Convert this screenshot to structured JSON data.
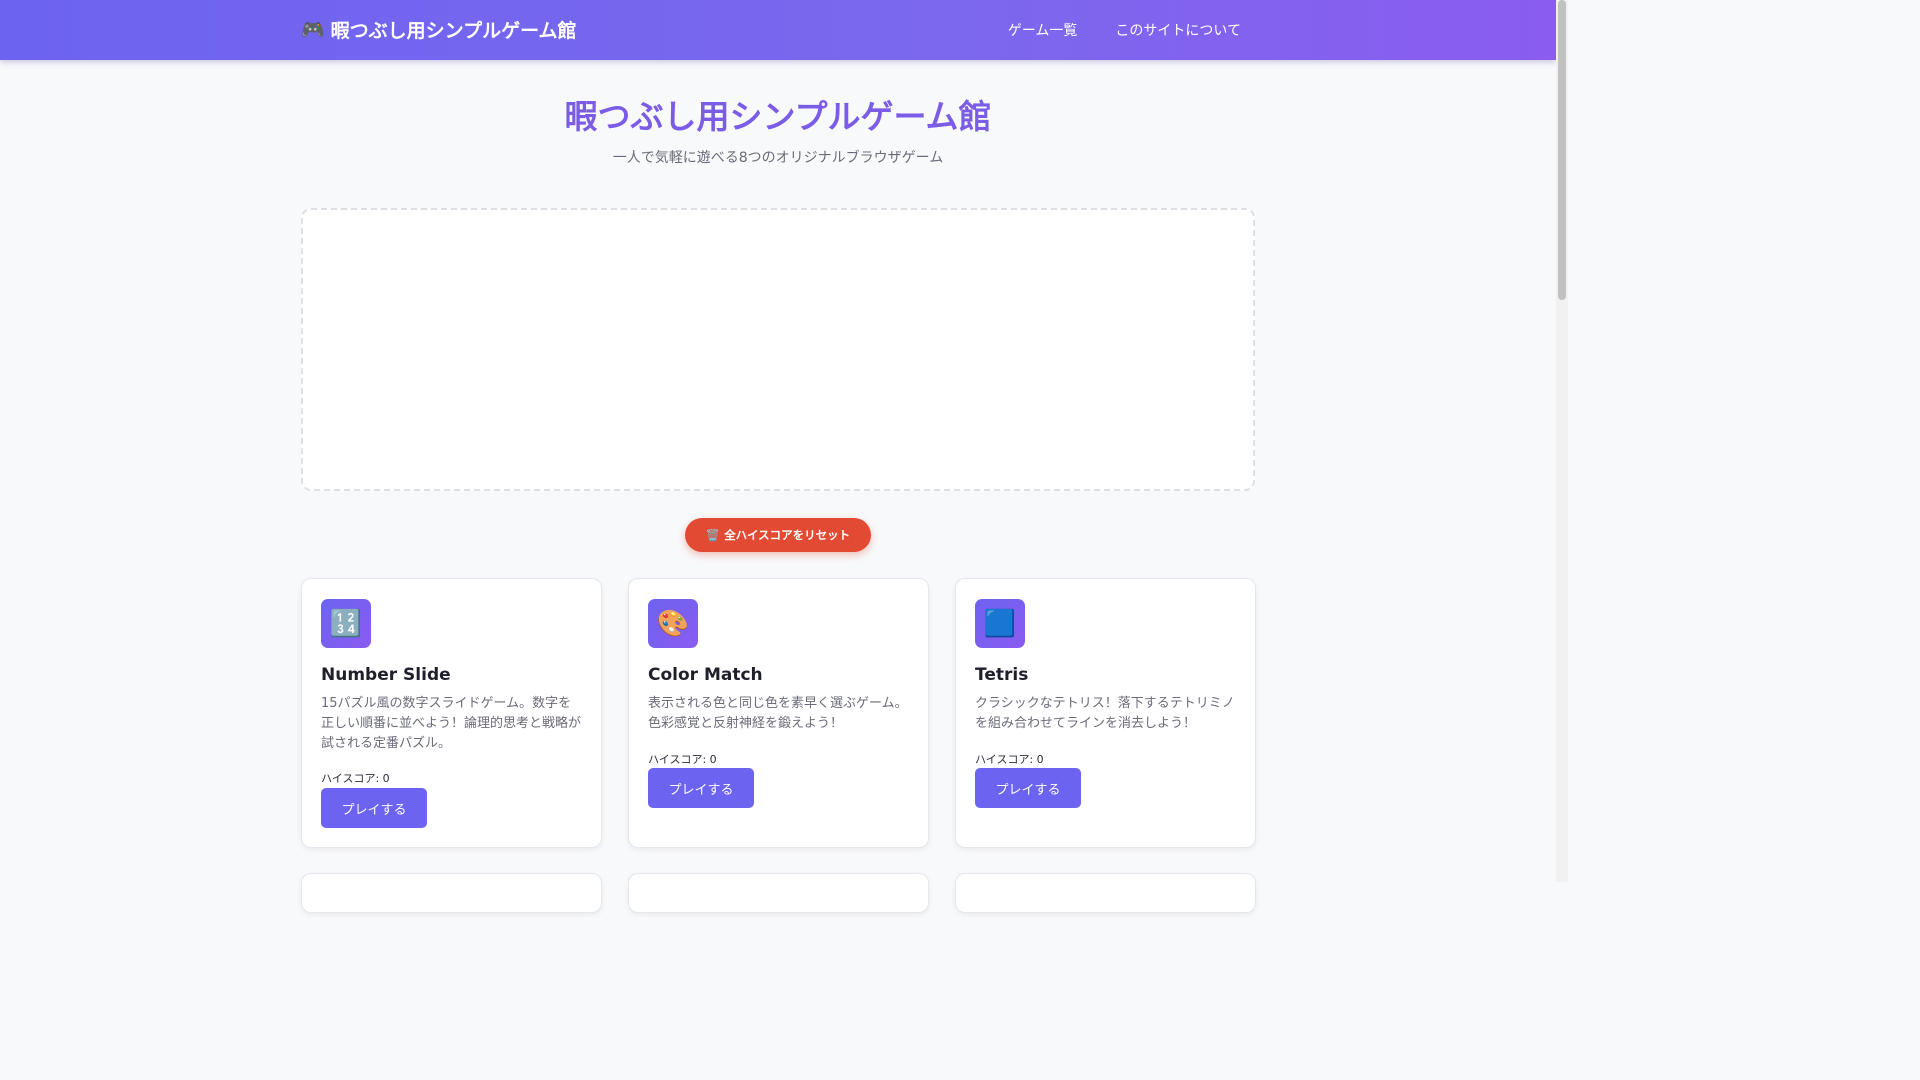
{
  "header": {
    "logo_icon": "🎮",
    "logo_text": "暇つぶし用シンプルゲーム館",
    "nav": [
      {
        "label": "ゲーム一覧"
      },
      {
        "label": "このサイトについて"
      }
    ]
  },
  "hero": {
    "title": "暇つぶし用シンプルゲーム館",
    "subtitle": "一人で気軽に遊べる8つのオリジナルブラウザゲーム"
  },
  "reset_button": {
    "icon": "🗑️",
    "label": "全ハイスコアをリセット"
  },
  "games": [
    {
      "icon": "🔢",
      "title": "Number Slide",
      "description": "15パズル風の数字スライドゲーム。数字を正しい順番に並べよう！論理的思考と戦略が試される定番パズル。",
      "score": "ハイスコア: 0",
      "play_label": "プレイする"
    },
    {
      "icon": "🎨",
      "title": "Color Match",
      "description": "表示される色と同じ色を素早く選ぶゲーム。色彩感覚と反射神経を鍛えよう！",
      "score": "ハイスコア: 0",
      "play_label": "プレイする"
    },
    {
      "icon": "🟦",
      "title": "Tetris",
      "description": "クラシックなテトリス！落下するテトリミノを組み合わせてラインを消去しよう！",
      "score": "ハイスコア: 0",
      "play_label": "プレイする"
    }
  ],
  "colors": {
    "accent": "#6c63f0",
    "title": "#7b5ce6",
    "reset": "#e24a33"
  }
}
